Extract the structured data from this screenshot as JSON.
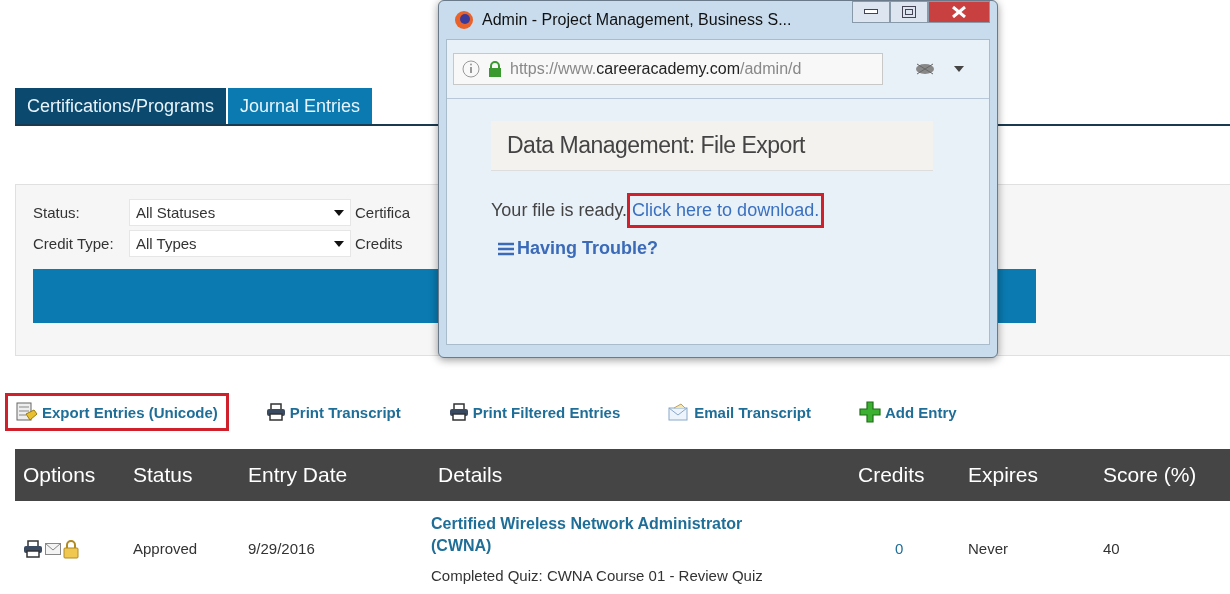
{
  "tabs": [
    {
      "label": "Certifications/Programs",
      "selected": true
    },
    {
      "label": "Journal Entries",
      "selected": false
    }
  ],
  "filters": [
    {
      "label": "Status:",
      "value": "All Statuses"
    },
    {
      "label": "Credit Type:",
      "value": "All Types"
    }
  ],
  "filter_labels_col2": [
    "Certifica",
    "Credits"
  ],
  "actions": [
    {
      "label": "Export Entries (Unicode)",
      "kind": "export",
      "highlighted": true
    },
    {
      "label": "Print Transcript",
      "kind": "print",
      "highlighted": false
    },
    {
      "label": "Print Filtered Entries",
      "kind": "print",
      "highlighted": false
    },
    {
      "label": "Email Transcript",
      "kind": "email",
      "highlighted": false
    },
    {
      "label": "Add Entry",
      "kind": "add",
      "highlighted": false
    }
  ],
  "table": {
    "columns": [
      "Options",
      "Status",
      "Entry Date",
      "Details",
      "Credits",
      "Expires",
      "Score (%)"
    ],
    "rows": [
      {
        "status": "Approved",
        "entry_date": "9/29/2016",
        "title": "Certified Wireless Network Administrator (CWNA)",
        "description": "Completed Quiz: CWNA Course 01 - Review Quiz",
        "credits": "0",
        "expires": "Never",
        "score": "40"
      }
    ]
  },
  "popup": {
    "title": "Admin - Project Management, Business S...",
    "url_scheme": "https://www.",
    "url_domain": "careeracademy.com",
    "url_path": "/admin/d",
    "heading": "Data Management: File Export",
    "message": "Your file is ready.",
    "link": {
      "label": "Click here to download.",
      "highlighted": true
    },
    "help": "Having Trouble?"
  }
}
